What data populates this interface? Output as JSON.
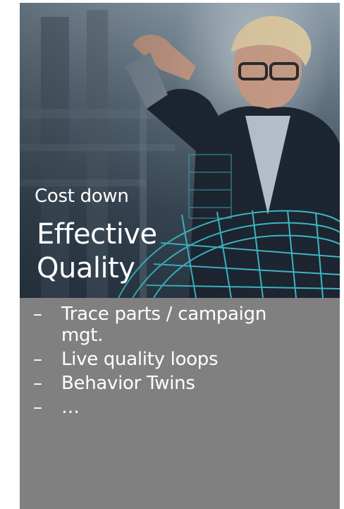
{
  "card": {
    "eyebrow": "Cost down",
    "headline": "Effective Quality",
    "image_description_icon": "woman-with-holographic-car-photo",
    "bullet_marker": "–",
    "bullets": [
      "Trace parts / campaign mgt.",
      "Live quality loops",
      "Behavior Twins",
      "…"
    ],
    "colors": {
      "panel": "#808080",
      "text": "#ffffff"
    }
  }
}
